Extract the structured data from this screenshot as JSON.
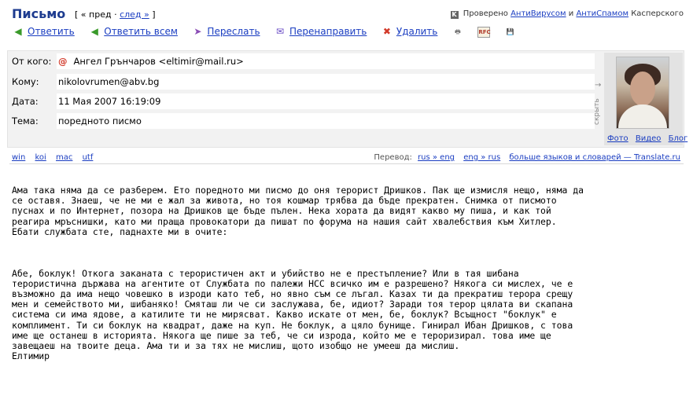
{
  "header": {
    "title": "Письмо",
    "nav_open": "[",
    "prev_label": "« пред",
    "nav_sep": "·",
    "next_label": "след »",
    "nav_close": "]",
    "kaspersky_prefix": "Проверено",
    "antivirus_link": "АнтиВирусом",
    "kaspersky_and": "и",
    "antispam_link": "АнтиСпамом",
    "kaspersky_suffix": "Касперского"
  },
  "toolbar": {
    "reply": "Ответить",
    "reply_all": "Ответить всем",
    "forward": "Переслать",
    "redirect": "Перенаправить",
    "delete": "Удалить",
    "rfc_icon_text": "RFC"
  },
  "message": {
    "from_label": "От кого:",
    "from_value": "Ангел Грънчаров <eltimir@mail.ru>",
    "to_label": "Кому:",
    "to_value": "nikolovrumen@abv.bg",
    "date_label": "Дата:",
    "date_value": "11 Мая 2007 16:19:09",
    "subject_label": "Тема:",
    "subject_value": "поредното писмо",
    "hide_label": "скрыть",
    "photo_links": [
      "Фото",
      "Видео",
      "Блог"
    ]
  },
  "encodings": [
    "win",
    "koi",
    "mac",
    "utf"
  ],
  "translate": {
    "label": "Перевод:",
    "rus_eng": "rus » eng",
    "eng_rus": "eng » rus",
    "more": "больше языков и словарей — Translate.ru"
  },
  "body_lines": [
    "Ама така няма да се разберем. Ето поредното ми писмо до оня терорист Дришков. Пак ще измисля нещо, няма да",
    "се оставя. Знаеш, че не ми е жал за живота, но тоя кошмар трябва да бъде прекратен. Снимка от писмото",
    "пуснах и по Интернет, позора на Дришков ще бъде пълен. Нека хората да видят какво му пиша, и как той",
    "реагира мръснишки, като ми праща провокатори да пишат по форума на нашия сайт хвалебствия към Хитлер.",
    "Ебати службата сте, паднахте ми в очите:",
    "",
    "",
    "",
    "Абе, боклук! Откога заканата с терористичен акт и убийство не е престъпление? Или в тая шибана",
    "терористична държава на агентите от Службата по палежи НСС всичко им е разрешено? Някога си мислех, че е",
    "възможно да има нещо човешко в изроди като теб, но явно съм се лъгал. Казах ти да прекратиш терора срещу",
    "мен и семейството ми, шибаняко! Смяташ ли че си заслужава, бе, идиот? Заради тоя терор цялата ви скапана",
    "система си има ядове, а катилите ти не мирясват. Какво искате от мен, бе, боклук? Всъщност \"боклук\" е",
    "комплимент. Ти си боклук на квадрат, даже на куп. Не боклук, а цяло бунище. Гинирал Ибан Дришков, с това",
    "име ще останеш в историята. Някога ще пише за теб, че си изрода, който ме е тероризирал. това име ще",
    "завещаеш на твоите деца. Ама ти и за тях не мислиш, щото изобщо не умееш да мислиш.",
    "Елтимир"
  ]
}
